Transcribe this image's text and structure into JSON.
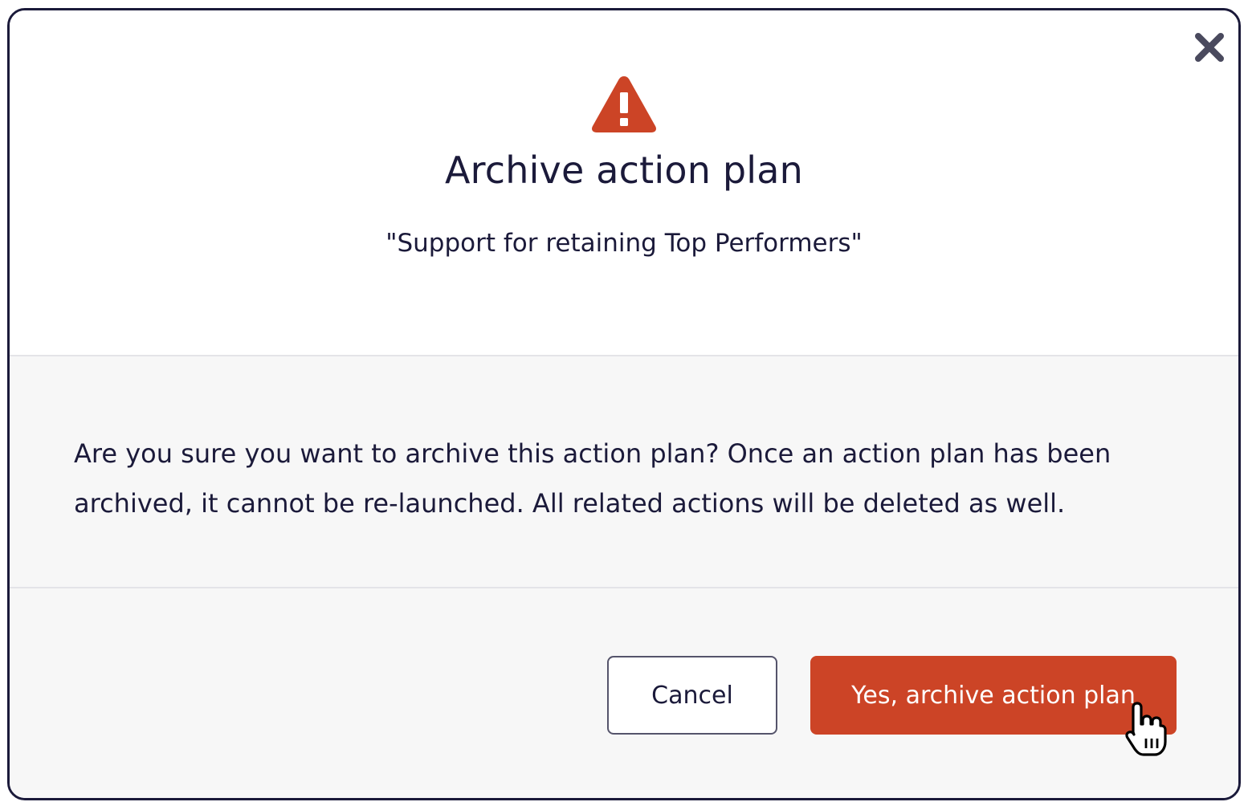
{
  "dialog": {
    "title": "Archive action plan",
    "subtitle": "\"Support for retaining Top Performers\"",
    "message": "Are you sure you want to archive this action plan? Once an action plan has been archived, it cannot be re-launched. All related actions will be deleted as well.",
    "cancel_label": "Cancel",
    "confirm_label": "Yes, archive action plan",
    "icons": {
      "warning": "warning-triangle-icon",
      "close": "close-icon",
      "cursor": "hand-pointer-cursor"
    },
    "colors": {
      "accent": "#cc4426",
      "text": "#1b1a3a",
      "border": "#1b1a3a",
      "body_bg": "#f7f7f7"
    }
  }
}
